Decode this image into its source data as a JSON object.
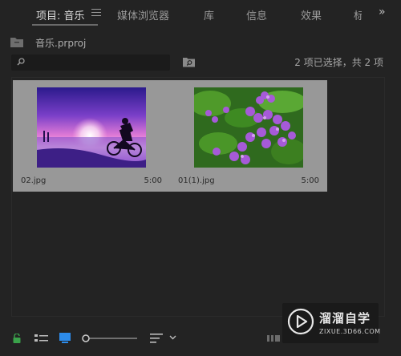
{
  "tabs": [
    {
      "label": "项目: 音乐",
      "active": true
    },
    {
      "label": "媒体浏览器",
      "active": false
    },
    {
      "label": "库",
      "active": false
    },
    {
      "label": "信息",
      "active": false
    },
    {
      "label": "效果",
      "active": false
    },
    {
      "label": "标",
      "active": false
    }
  ],
  "overflow_glyph": "»",
  "project": {
    "name": "音乐.prproj"
  },
  "search": {
    "placeholder": ""
  },
  "selection_status": "2 项已选择，共 2 项",
  "clips": [
    {
      "name": "02.jpg",
      "duration": "5:00",
      "thumbnail": "sunset-cyclist"
    },
    {
      "name": "01(1).jpg",
      "duration": "5:00",
      "thumbnail": "purple-flowers"
    }
  ],
  "watermark": {
    "title": "溜溜自学",
    "subtitle": "ZIXUE.3D66.COM"
  },
  "colors": {
    "panel_bg": "#232323",
    "clip_bg": "#989898",
    "lock_green": "#3aa24a",
    "accent_blue": "#2d8ceb"
  }
}
